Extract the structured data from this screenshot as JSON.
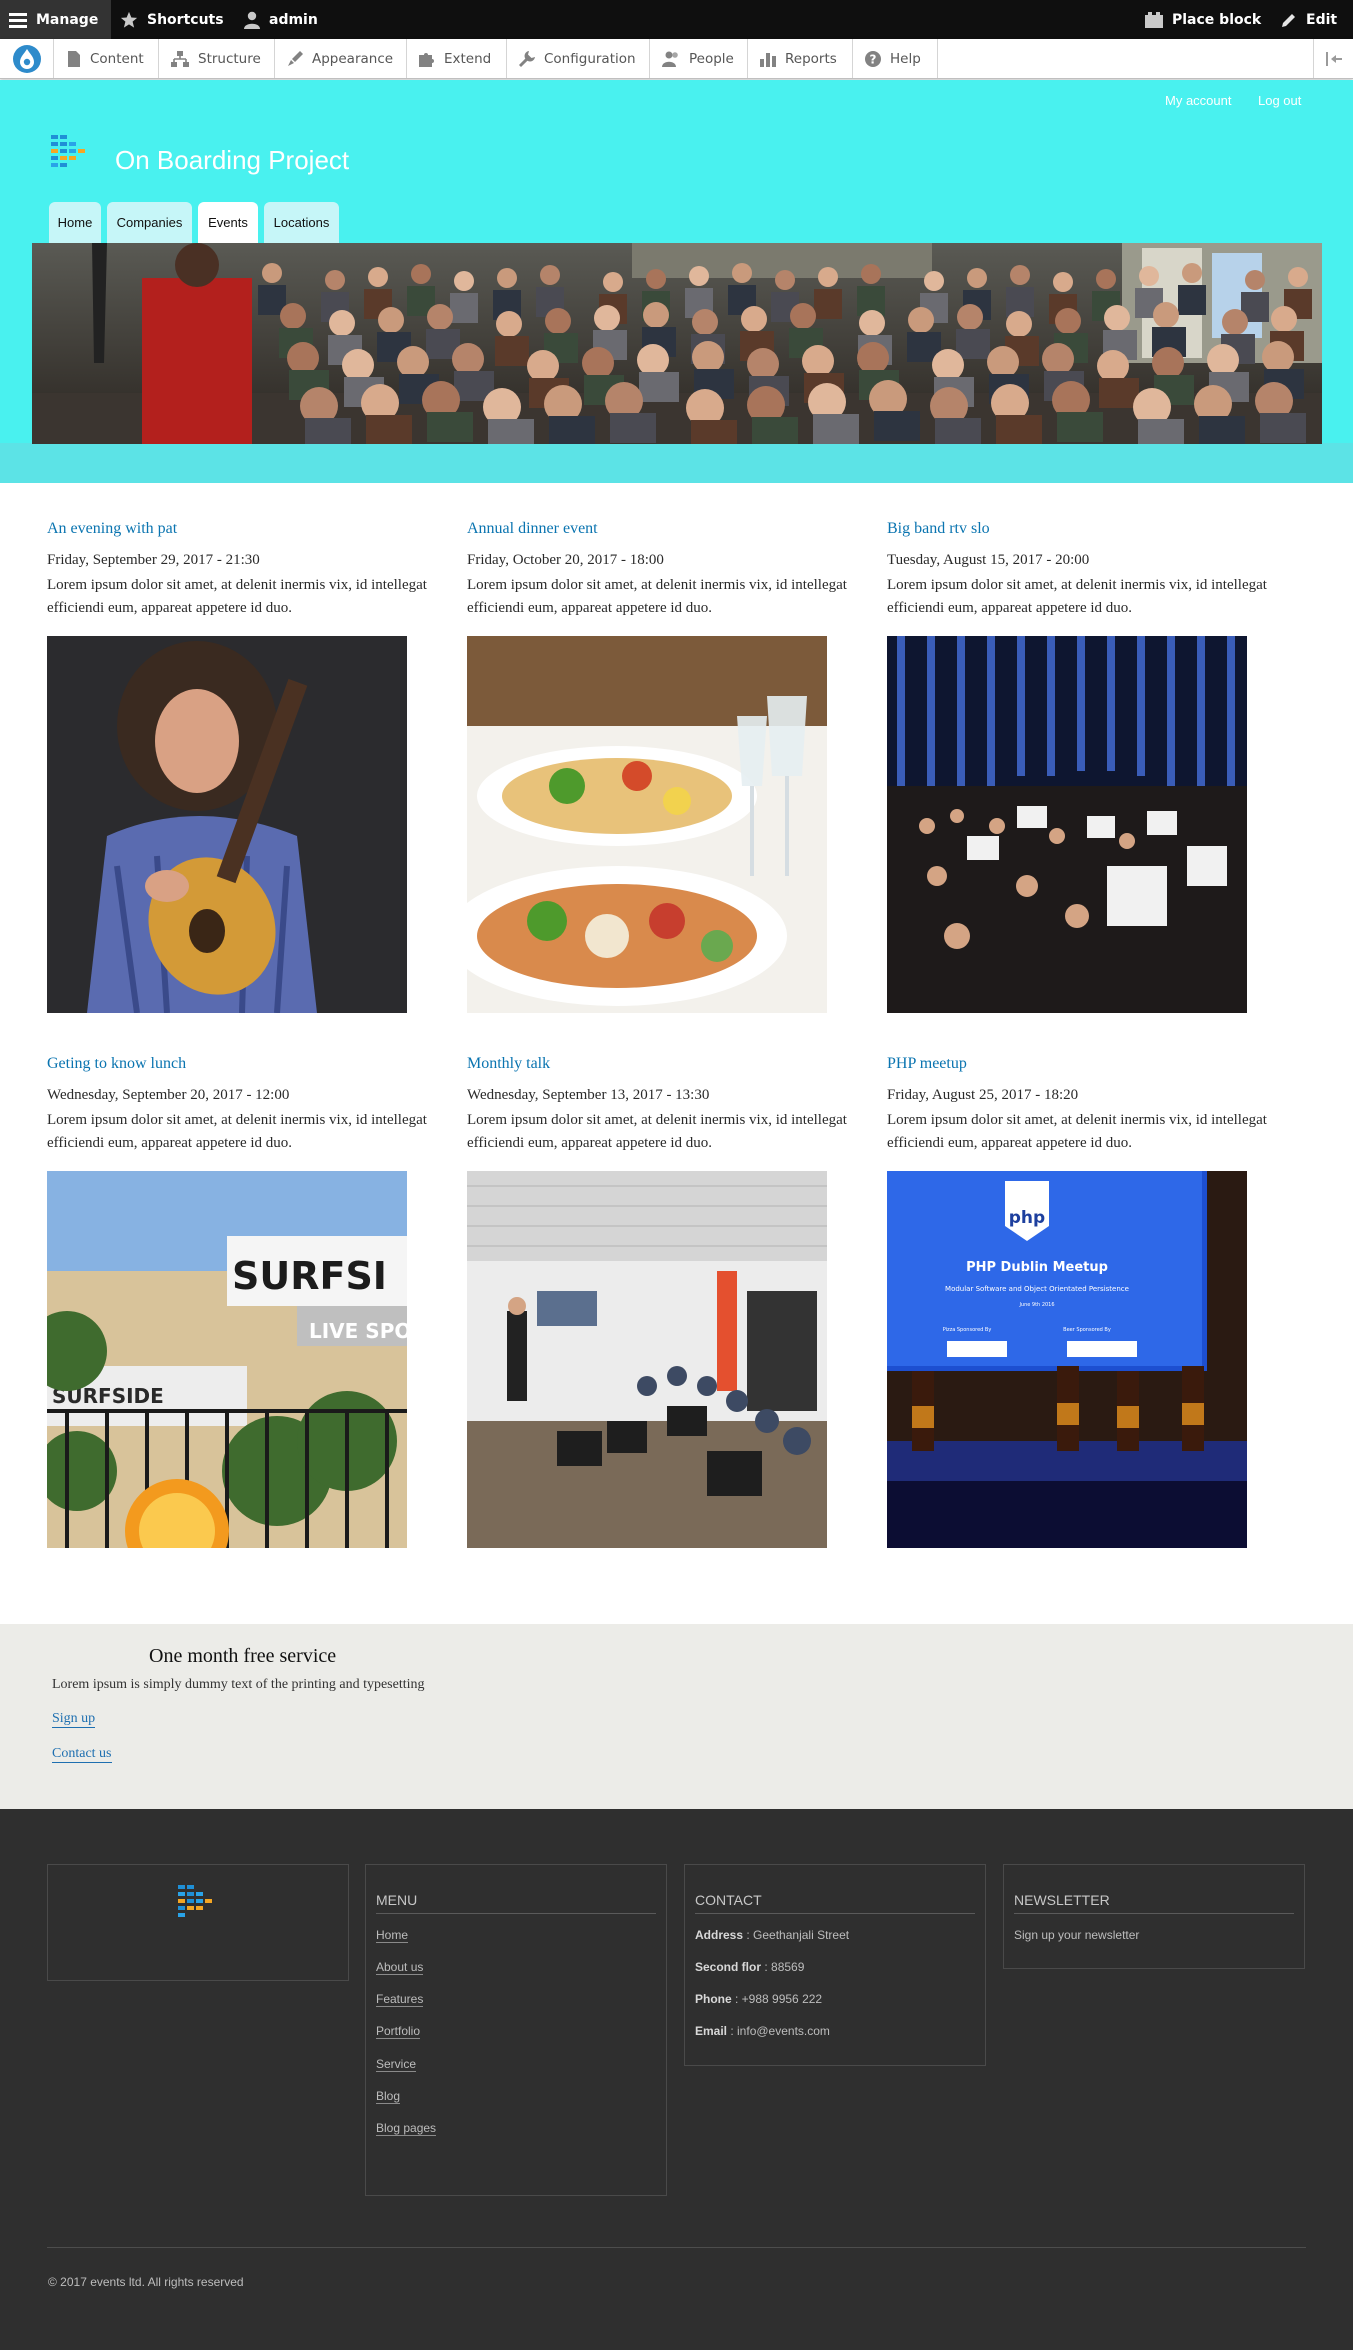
{
  "toolbar": {
    "manage": "Manage",
    "shortcuts": "Shortcuts",
    "user": "admin",
    "place_block": "Place block",
    "edit": "Edit"
  },
  "tray": {
    "items": [
      "Content",
      "Structure",
      "Appearance",
      "Extend",
      "Configuration",
      "People",
      "Reports",
      "Help"
    ]
  },
  "header": {
    "secondary_menu": [
      "My account",
      "Log out"
    ],
    "site_name": "On Boarding Project",
    "tabs": [
      "Home",
      "Companies",
      "Events",
      "Locations"
    ],
    "active_tab": "Events"
  },
  "events": [
    {
      "title": "An evening with pat",
      "date": "Friday, September 29, 2017 - 21:30",
      "body": "Lorem ipsum dolor sit amet, at delenit inermis vix, id intellegat efficiendi eum, appareat appetere id duo.",
      "image": "guitarist-photo"
    },
    {
      "title": "Annual dinner event",
      "date": "Friday, October 20, 2017 - 18:00",
      "body": "Lorem ipsum dolor sit amet, at delenit inermis vix, id intellegat efficiendi eum, appareat appetere id duo.",
      "image": "dinner-table-photo"
    },
    {
      "title": "Big band rtv slo",
      "date": "Tuesday, August 15, 2017 - 20:00",
      "body": "Lorem ipsum dolor sit amet, at delenit inermis vix, id intellegat efficiendi eum, appareat appetere id duo.",
      "image": "orchestra-photo"
    },
    {
      "title": "Geting to know lunch",
      "date": "Wednesday, September 20, 2017 - 12:00",
      "body": "Lorem ipsum dolor sit amet, at delenit inermis vix, id intellegat efficiendi eum, appareat appetere id duo.",
      "image": "restaurant-photo"
    },
    {
      "title": "Monthly talk",
      "date": "Wednesday, September 13, 2017 - 13:30",
      "body": "Lorem ipsum dolor sit amet, at delenit inermis vix, id intellegat efficiendi eum, appareat appetere id duo.",
      "image": "talk-photo"
    },
    {
      "title": "PHP meetup",
      "date": "Friday, August 25, 2017 - 18:20",
      "body": "Lorem ipsum dolor sit amet, at delenit inermis vix, id intellegat efficiendi eum, appareat appetere id duo.",
      "image": "meetup-photo"
    }
  ],
  "image_text": {
    "surfside": "SURFSI",
    "live_sport": "LIVE SPOR",
    "surfside_small": "SURFSIDE",
    "php": "php",
    "php_meetup": "PHP Dublin Meetup",
    "php_sub": "Modular Software and Object Orientated Persistence",
    "php_date": "June 9th 2016",
    "php_sponsor_left": "Pizza Sponsored By",
    "php_sponsor_right": "Beer Sponsored By"
  },
  "promo": {
    "title": "One month free service",
    "text": "Lorem ipsum is simply dummy text of the printing and typesetting",
    "links": [
      "Sign up",
      "Contact us"
    ]
  },
  "footer": {
    "menu_title": "MENU",
    "menu_items": [
      "Home",
      "About us",
      "Features",
      "Portfolio",
      "Service",
      "Blog",
      "Blog pages"
    ],
    "contact_title": "CONTACT",
    "contact": [
      {
        "label": "Address",
        "value": " : Geethanjali Street"
      },
      {
        "label": "Second flor",
        "value": " : 88569"
      },
      {
        "label": "Phone",
        "value": " : +988 9956 222"
      },
      {
        "label": "Email",
        "value": " : info@events.com"
      }
    ],
    "newsletter_title": "NEWSLETTER",
    "newsletter_text": "Sign up your newsletter",
    "copyright": "© 2017 events ltd. All rights reserved"
  },
  "colors": {
    "header_bg": "#49f1ef",
    "link": "#0a74b0",
    "footer_bg": "#2f2f2f",
    "promo_bg": "#ecece8"
  }
}
